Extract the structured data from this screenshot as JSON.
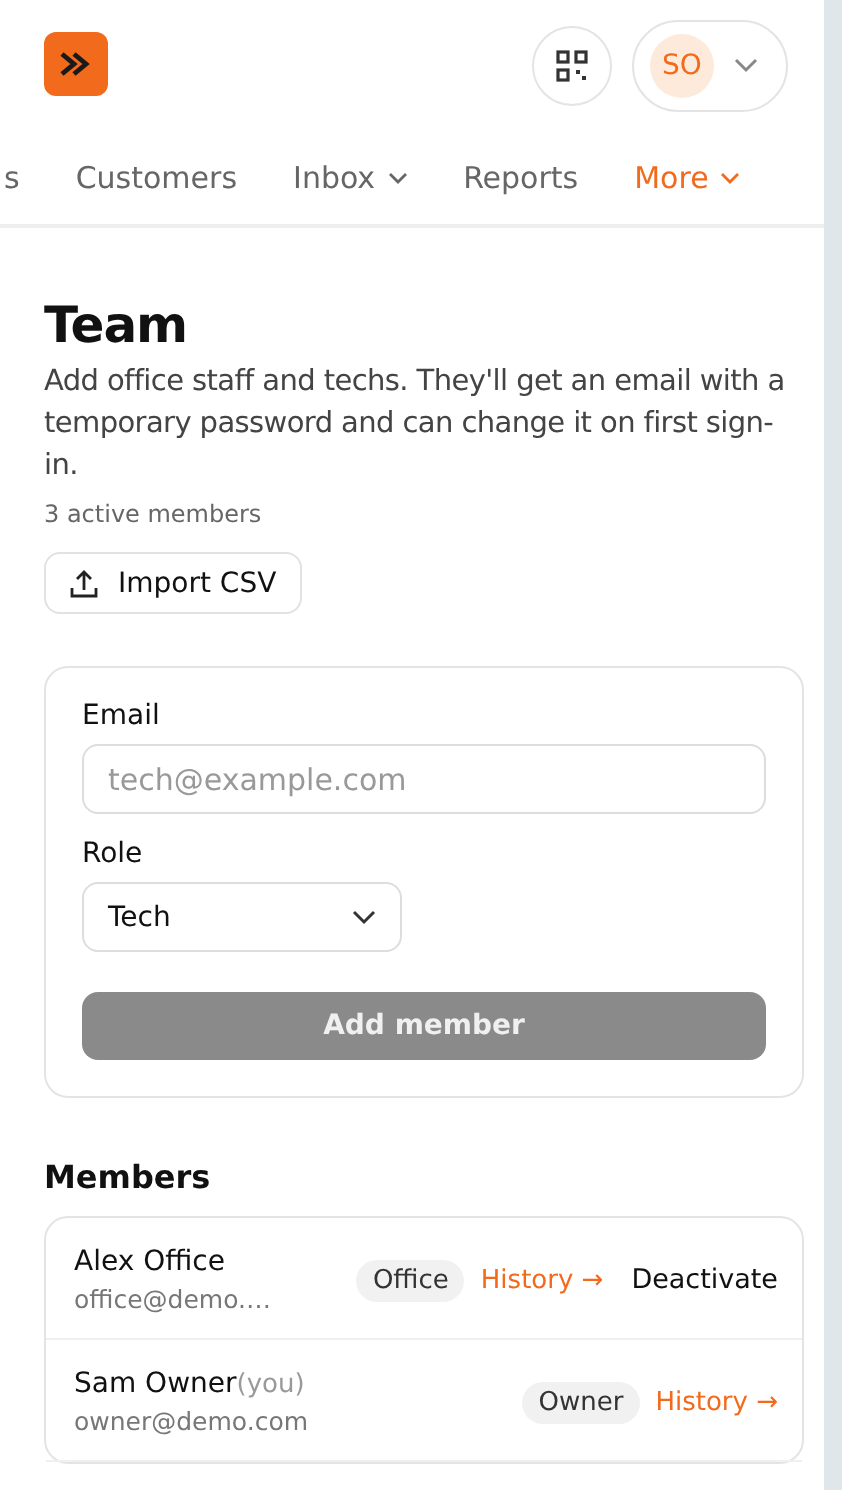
{
  "header": {
    "avatar": "SO"
  },
  "nav": [
    {
      "label": "s",
      "dropdown": false,
      "selected": false
    },
    {
      "label": "Customers",
      "dropdown": false,
      "selected": false
    },
    {
      "label": "Inbox",
      "dropdown": true,
      "selected": false
    },
    {
      "label": "Reports",
      "dropdown": false,
      "selected": false
    },
    {
      "label": "More",
      "dropdown": true,
      "selected": true
    }
  ],
  "title": "Team",
  "description": "Add office staff and techs. They'll get an email with a temporary password and can change it on first sign-in.",
  "count": "3 active members",
  "import_button": "Import CSV",
  "form": {
    "email_label": "Email",
    "email_placeholder": "tech@example.com",
    "role_label": "Role",
    "role_value": "Tech",
    "submit": "Add member",
    "submit_disabled": true
  },
  "members_title": "Members",
  "members": [
    {
      "name": "Alex Office",
      "email": "office@demo.…",
      "role": "Office",
      "history": "History →",
      "action": "Deactivate"
    },
    {
      "name": "Sam Owner",
      "you": "(you)",
      "email": "owner@demo.com",
      "role": "Owner",
      "history": "History →"
    }
  ]
}
